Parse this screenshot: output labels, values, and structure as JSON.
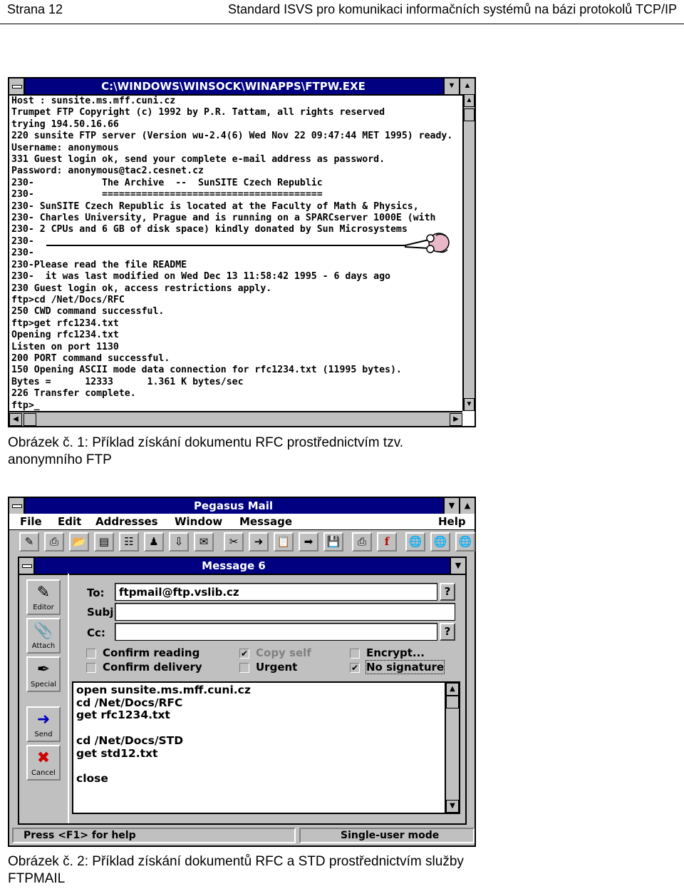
{
  "page_header": {
    "left": "Strana 12",
    "right": "Standard ISVS pro komunikaci informačních systémů na bázi protokolů TCP/IP"
  },
  "figure1": {
    "window_title": "C:\\WINDOWS\\WINSOCK\\WINAPPS\\FTPW.EXE",
    "lines": [
      "Host : sunsite.ms.mff.cuni.cz",
      "Trumpet FTP Copyright (c) 1992 by P.R. Tattam, all rights reserved",
      "trying 194.50.16.66",
      "220 sunsite FTP server (Version wu-2.4(6) Wed Nov 22 09:47:44 MET 1995) ready.",
      "Username: anonymous",
      "331 Guest login ok, send your complete e-mail address as password.",
      "Password: anonymous@tac2.cesnet.cz",
      "230-            The Archive  --  SunSITE Czech Republic",
      "230-            =======================================",
      "230- SunSITE Czech Republic is located at the Faculty of Math & Physics,",
      "230- Charles University, Prague and is running on a SPARCserver 1000E (with",
      "230- 2 CPUs and 6 GB of disk space) kindly donated by Sun Microsystems",
      "230-",
      "230-",
      "230-Please read the file README",
      "230-  it was last modified on Wed Dec 13 11:58:42 1995 - 6 days ago",
      "230 Guest login ok, access restrictions apply.",
      "ftp>cd /Net/Docs/RFC",
      "250 CWD command successful.",
      "ftp>get rfc1234.txt",
      "Opening rfc1234.txt",
      "Listen on port 1130",
      "200 PORT command successful.",
      "150 Opening ASCII mode data connection for rfc1234.txt (11995 bytes).",
      "Bytes =      12333      1.361 K bytes/sec",
      "226 Transfer complete.",
      "ftp>_"
    ],
    "caption": "Obrázek č. 1: Příklad získání dokumentu RFC prostřednictvím tzv. anonymního FTP"
  },
  "figure2": {
    "window_title": "Pegasus Mail",
    "menu": [
      "File",
      "Edit",
      "Addresses",
      "Window",
      "Message",
      "Help"
    ],
    "message_title": "Message 6",
    "side_buttons": [
      "Editor",
      "Attach",
      "Special",
      "Send",
      "Cancel"
    ],
    "to_label": "To:",
    "to_value": "ftpmail@ftp.vslib.cz",
    "subj_label": "Subj:",
    "subj_value": "",
    "cc_label": "Cc:",
    "cc_value": "",
    "question_mark": "?",
    "options": {
      "confirm_reading": "Confirm reading",
      "confirm_delivery": "Confirm delivery",
      "copy_self": "Copy self",
      "urgent": "Urgent",
      "encrypt": "Encrypt...",
      "no_signature": "No signature"
    },
    "body_lines": [
      "open sunsite.ms.mff.cuni.cz",
      "cd /Net/Docs/RFC",
      "get rfc1234.txt",
      "",
      "cd /Net/Docs/STD",
      "get std12.txt",
      "",
      "close"
    ],
    "status_left": "Press <F1> for help",
    "status_right": "Single-user mode",
    "caption": "Obrázek č. 2: Příklad získání dokumentů RFC a STD prostřednictvím služby FTPMAIL"
  },
  "colors": {
    "title_bar": "#000080",
    "window_face": "#c0c0c0"
  }
}
